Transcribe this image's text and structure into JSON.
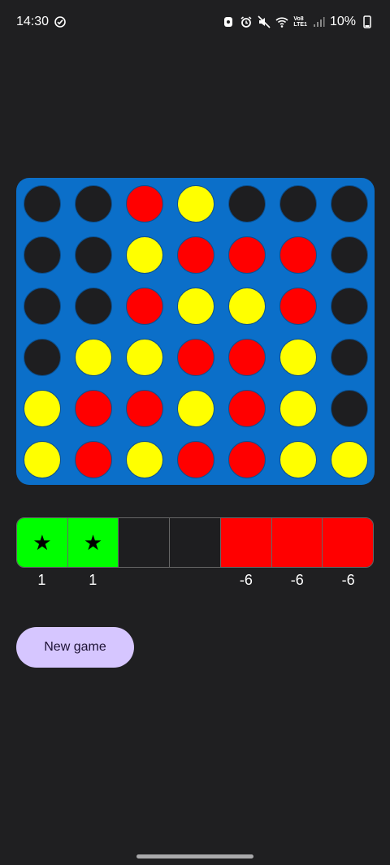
{
  "status": {
    "time": "14:30",
    "battery": "10%",
    "network": [
      "Vo8",
      "LTE1"
    ],
    "icons": [
      "check-circle-icon",
      "bixby-icon",
      "alarm-icon",
      "mute-icon",
      "wifi-icon",
      "signal-icon",
      "battery-icon"
    ]
  },
  "board": {
    "rows": [
      [
        "empty",
        "empty",
        "red",
        "yellow",
        "empty",
        "empty",
        "empty"
      ],
      [
        "empty",
        "empty",
        "yellow",
        "red",
        "red",
        "red",
        "empty"
      ],
      [
        "empty",
        "empty",
        "red",
        "yellow",
        "yellow",
        "red",
        "empty"
      ],
      [
        "empty",
        "yellow",
        "yellow",
        "red",
        "red",
        "yellow",
        "empty"
      ],
      [
        "yellow",
        "red",
        "red",
        "yellow",
        "red",
        "yellow",
        "empty"
      ],
      [
        "yellow",
        "red",
        "yellow",
        "red",
        "red",
        "yellow",
        "yellow"
      ]
    ],
    "colors": {
      "board": "#0b6fc9",
      "red": "#ff0000",
      "yellow": "#ffff00",
      "empty": "#1e1e20"
    }
  },
  "scores": {
    "columns": [
      {
        "state": "win",
        "color": "#00ff00",
        "icon": "star-icon",
        "label": "1"
      },
      {
        "state": "win",
        "color": "#00ff00",
        "icon": "star-icon",
        "label": "1"
      },
      {
        "state": "neutral",
        "color": "#1e1e20",
        "icon": "",
        "label": ""
      },
      {
        "state": "neutral",
        "color": "#1e1e20",
        "icon": "",
        "label": ""
      },
      {
        "state": "lose",
        "color": "#ff0000",
        "icon": "",
        "label": "-6"
      },
      {
        "state": "lose",
        "color": "#ff0000",
        "icon": "",
        "label": "-6"
      },
      {
        "state": "lose",
        "color": "#ff0000",
        "icon": "",
        "label": "-6"
      }
    ]
  },
  "actions": {
    "new_game_label": "New game"
  }
}
